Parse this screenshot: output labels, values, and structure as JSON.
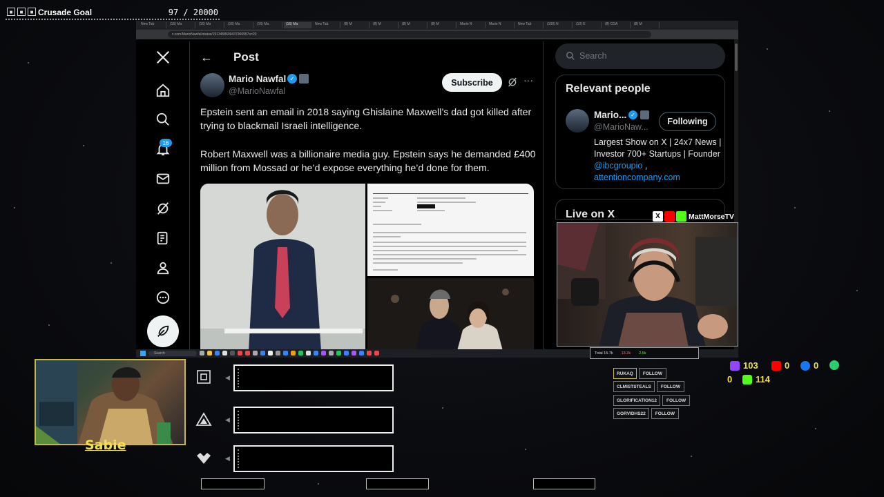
{
  "goal": {
    "title": "Crusade Goal",
    "count": "97 / 20000"
  },
  "browser": {
    "tabs": [
      "New Tab",
      "(16) Ma",
      "(16) Ma",
      "(16) Ma",
      "(16) Ma",
      "(16) Ma",
      "New Tab",
      "(8) M",
      "(8) M",
      "(8) M",
      "(8) M",
      "Mario N",
      "Mario N",
      "New Tab",
      "(100) N",
      "(10) E",
      "(8) CGA",
      "(8) M"
    ],
    "url": "x.com/MarioNawfal/status/1913458699437966957s=20"
  },
  "x": {
    "nav": {
      "logo": "X",
      "notif_count": "16"
    },
    "header": {
      "title": "Post"
    },
    "post": {
      "author_name": "Mario Nawfal",
      "author_handle": "@MarioNawfal",
      "subscribe_label": "Subscribe",
      "text1": "Epstein sent an email in 2018 saying Ghislaine Maxwell’s dad got killed after trying to blackmail Israeli intelligence.",
      "text2": "Robert Maxwell was a billionaire media guy. Epstein says he demanded £400 million from Mossad or he’d expose everything he’d done for them."
    },
    "search": {
      "placeholder": "Search"
    },
    "relevant": {
      "title": "Relevant people",
      "name": "Mario...",
      "handle": "@MarioNaw...",
      "follow_label": "Following",
      "bio_prefix": "Largest Show on X | 24x7 News | Investor 700+ Startups | Founder ",
      "bio_link1": "@ibcgroupio",
      "bio_sep": " ,",
      "bio_link2": "attentioncompany.com"
    },
    "live": {
      "title": "Live on X"
    }
  },
  "taskbar": {
    "search": "Search"
  },
  "camera": {
    "channel": "MattMorseTV",
    "stats": [
      "Total 15.7k",
      "13.2k",
      "2.5k"
    ]
  },
  "facecam": {
    "name": "Sabie"
  },
  "counters": {
    "twitch": "103",
    "youtube": "0",
    "facebook": "0",
    "other": "0",
    "kick": "114"
  },
  "follows": [
    {
      "name": "RUKAQ",
      "tag": "FOLLOW"
    },
    {
      "name": "CLMISTSTEALS",
      "tag": "FOLLOW"
    },
    {
      "name": "GLORIFICATION12",
      "tag": "FOLLOW"
    },
    {
      "name": "GORVIDHS22",
      "tag": "FOLLOW"
    }
  ],
  "colors": {
    "accent": "#1d9bf0",
    "overlay_gold": "#f2e04a",
    "twitch": "#9146ff",
    "youtube": "#ff0000",
    "kick": "#53fc18"
  }
}
